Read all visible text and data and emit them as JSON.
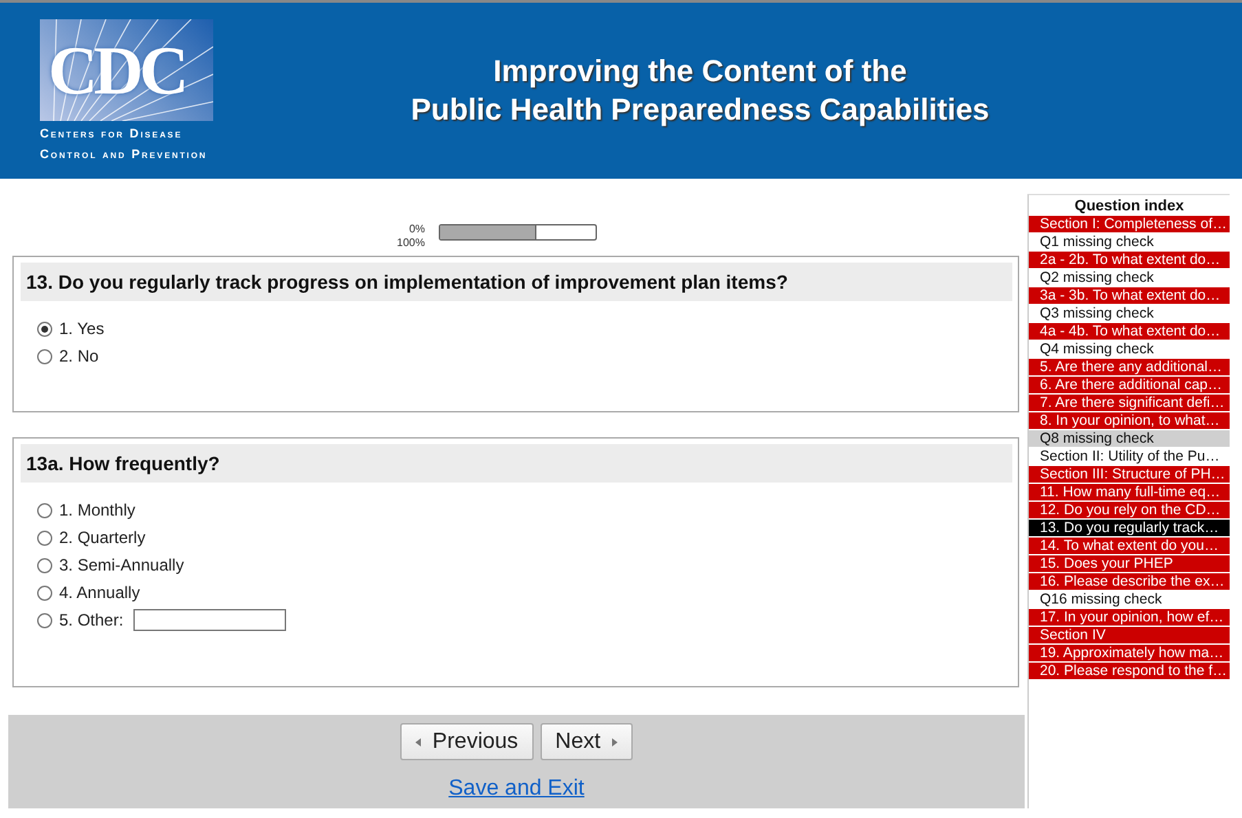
{
  "header": {
    "logo": {
      "letters": "CDC",
      "line_1": "Centers for Disease",
      "line_2": "Control and Prevention"
    },
    "title_1": "Improving the Content of the",
    "title_2": "Public Health Preparedness Capabilities"
  },
  "progress": {
    "start_label": "0%",
    "end_label": "100%",
    "level": 0.62
  },
  "questions": [
    {
      "title": "13. Do you regularly track progress on implementation of improvement plan items?",
      "options": [
        {
          "label": "1. Yes",
          "selected": true
        },
        {
          "label": "2. No",
          "selected": false
        }
      ]
    },
    {
      "title": "13a. How frequently?",
      "options": [
        {
          "label": "1. Monthly",
          "selected": false
        },
        {
          "label": "2. Quarterly",
          "selected": false
        },
        {
          "label": "3. Semi-Annually",
          "selected": false
        },
        {
          "label": "4. Annually",
          "selected": false
        },
        {
          "label": "5. Other:",
          "selected": false,
          "has_text_field": true
        }
      ]
    }
  ],
  "navigation": {
    "previous": "Previous",
    "next": "Next",
    "save": "Save and Exit"
  },
  "question_index": {
    "title": "Question index",
    "items": [
      {
        "label": "Section I: Completeness of…",
        "kind": "question",
        "selected": false,
        "hovered": false
      },
      {
        "label": "Q1 missing check",
        "kind": "note",
        "selected": false,
        "hovered": false
      },
      {
        "label": "2a - 2b. To what extent do…",
        "kind": "question",
        "selected": false,
        "hovered": false
      },
      {
        "label": "Q2 missing check",
        "kind": "note",
        "selected": false,
        "hovered": false
      },
      {
        "label": "3a - 3b. To what extent do…",
        "kind": "question",
        "selected": false,
        "hovered": false
      },
      {
        "label": "Q3 missing check",
        "kind": "note",
        "selected": false,
        "hovered": false
      },
      {
        "label": "4a - 4b. To what extent do…",
        "kind": "question",
        "selected": false,
        "hovered": false
      },
      {
        "label": "Q4 missing check",
        "kind": "note",
        "selected": false,
        "hovered": false
      },
      {
        "label": "5. Are there any additional…",
        "kind": "question",
        "selected": false,
        "hovered": false
      },
      {
        "label": "6. Are there additional cap…",
        "kind": "question",
        "selected": false,
        "hovered": false
      },
      {
        "label": "7. Are there significant defi…",
        "kind": "question",
        "selected": false,
        "hovered": false
      },
      {
        "label": "8. In your opinion, to what…",
        "kind": "question",
        "selected": false,
        "hovered": false
      },
      {
        "label": "Q8 missing check",
        "kind": "note",
        "selected": false,
        "hovered": true
      },
      {
        "label": "Section II: Utility of the Pu…",
        "kind": "note",
        "selected": false,
        "hovered": false
      },
      {
        "label": "Section III: Structure of PH…",
        "kind": "question",
        "selected": false,
        "hovered": false
      },
      {
        "label": "11. How many full-time eq…",
        "kind": "question",
        "selected": false,
        "hovered": false
      },
      {
        "label": "12. Do you rely on the CD…",
        "kind": "question",
        "selected": false,
        "hovered": false
      },
      {
        "label": "13. Do you regularly track…",
        "kind": "question",
        "selected": true,
        "hovered": false
      },
      {
        "label": "14. To what extent do you…",
        "kind": "question",
        "selected": false,
        "hovered": false
      },
      {
        "label": "15. Does your PHEP",
        "kind": "question",
        "selected": false,
        "hovered": false
      },
      {
        "label": "16. Please describe the ex…",
        "kind": "question",
        "selected": false,
        "hovered": false
      },
      {
        "label": "Q16 missing check",
        "kind": "note",
        "selected": false,
        "hovered": false
      },
      {
        "label": "17. In your opinion, how ef…",
        "kind": "question",
        "selected": false,
        "hovered": false
      },
      {
        "label": "Section IV",
        "kind": "question",
        "selected": false,
        "hovered": false
      },
      {
        "label": "19. Approximately how ma…",
        "kind": "question",
        "selected": false,
        "hovered": false
      },
      {
        "label": "20. Please respond to the f…",
        "kind": "question",
        "selected": false,
        "hovered": false
      }
    ]
  }
}
